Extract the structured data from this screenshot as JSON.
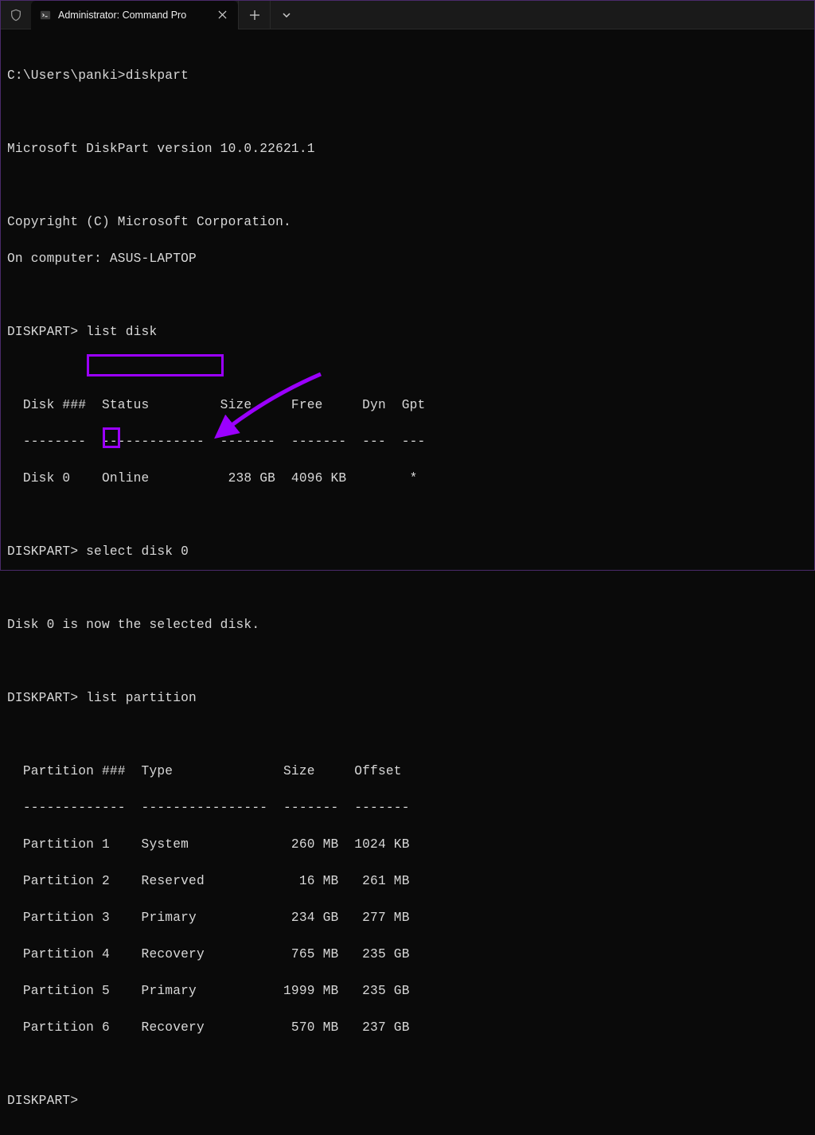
{
  "tab": {
    "title": "Administrator: Command Pro"
  },
  "lines": {
    "prompt1": "C:\\Users\\panki>diskpart",
    "blank": "",
    "version": "Microsoft DiskPart version 10.0.22621.1",
    "copyright": "Copyright (C) Microsoft Corporation.",
    "computer": "On computer: ASUS-LAPTOP",
    "dp1": "DISKPART> list disk",
    "disk_header": "  Disk ###  Status         Size     Free     Dyn  Gpt",
    "disk_divider": "  --------  -------------  -------  -------  ---  ---",
    "disk_row": "  Disk 0    Online          238 GB  4096 KB        *",
    "dp2": "DISKPART> select disk 0",
    "selected": "Disk 0 is now the selected disk.",
    "dp3": "DISKPART> list partition",
    "part_header": "  Partition ###  Type              Size     Offset",
    "part_divider": "  -------------  ----------------  -------  -------",
    "p1": "  Partition 1    System             260 MB  1024 KB",
    "p2": "  Partition 2    Reserved            16 MB   261 MB",
    "p3": "  Partition 3    Primary            234 GB   277 MB",
    "p4": "  Partition 4    Recovery           765 MB   235 GB",
    "p5": "  Partition 5    Primary           1999 MB   235 GB",
    "p6": "  Partition 6    Recovery           570 MB   237 GB",
    "dp4": "DISKPART>"
  }
}
